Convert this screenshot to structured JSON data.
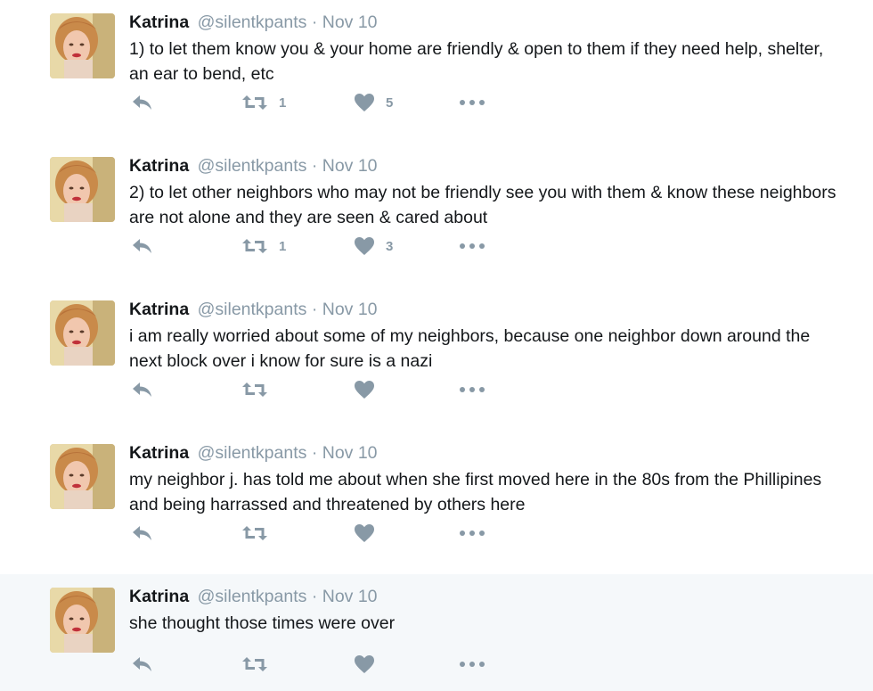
{
  "colors": {
    "text_primary": "#14171a",
    "text_secondary": "#8899a6",
    "highlight_bg": "#f5f8fa",
    "icon": "#8899a6"
  },
  "icons": {
    "reply": "reply-icon",
    "retweet": "retweet-icon",
    "like": "heart-icon",
    "more": "more-dots-icon"
  },
  "tweets": [
    {
      "name": "Katrina",
      "handle": "@silentkpants",
      "separator": "·",
      "date": "Nov 10",
      "text": "1) to let them know you & your home are friendly & open to them if they need help, shelter, an ear to bend, etc",
      "retweets": "1",
      "likes": "5"
    },
    {
      "name": "Katrina",
      "handle": "@silentkpants",
      "separator": "·",
      "date": "Nov 10",
      "text": "2) to let other neighbors who may not be friendly see you with them & know these neighbors are not alone and they are seen & cared about",
      "retweets": "1",
      "likes": "3"
    },
    {
      "name": "Katrina",
      "handle": "@silentkpants",
      "separator": "·",
      "date": "Nov 10",
      "text": "i am really worried about some of my neighbors, because one neighbor down around the next block over i know for sure is a nazi",
      "retweets": "",
      "likes": ""
    },
    {
      "name": "Katrina",
      "handle": "@silentkpants",
      "separator": "·",
      "date": "Nov 10",
      "text": "my neighbor j. has told me about when she first moved here in the 80s from the Phillipines and being harrassed and threatened by others here",
      "retweets": "",
      "likes": ""
    },
    {
      "name": "Katrina",
      "handle": "@silentkpants",
      "separator": "·",
      "date": "Nov 10",
      "text": "she thought those times were over",
      "retweets": "",
      "likes": ""
    }
  ]
}
